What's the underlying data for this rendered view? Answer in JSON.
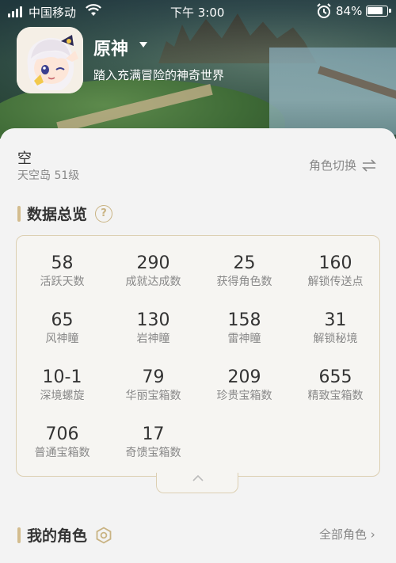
{
  "status_bar": {
    "carrier": "中国移动",
    "time": "下午 3:00",
    "battery": "84%",
    "battery_level": 0.84
  },
  "app": {
    "name": "原神",
    "tagline": "踏入充满冒险的神奇世界"
  },
  "character": {
    "name": "空",
    "server_level": "天空岛 51级",
    "switch_label": "角色切换"
  },
  "overview": {
    "title": "数据总览",
    "stats": [
      {
        "value": "58",
        "label": "活跃天数"
      },
      {
        "value": "290",
        "label": "成就达成数"
      },
      {
        "value": "25",
        "label": "获得角色数"
      },
      {
        "value": "160",
        "label": "解锁传送点"
      },
      {
        "value": "65",
        "label": "风神瞳"
      },
      {
        "value": "130",
        "label": "岩神瞳"
      },
      {
        "value": "158",
        "label": "雷神瞳"
      },
      {
        "value": "31",
        "label": "解锁秘境"
      },
      {
        "value": "10-1",
        "label": "深境螺旋"
      },
      {
        "value": "79",
        "label": "华丽宝箱数"
      },
      {
        "value": "209",
        "label": "珍贵宝箱数"
      },
      {
        "value": "655",
        "label": "精致宝箱数"
      },
      {
        "value": "706",
        "label": "普通宝箱数"
      },
      {
        "value": "17",
        "label": "奇馈宝箱数"
      }
    ]
  },
  "my_characters": {
    "title": "我的角色",
    "all_label": "全部角色 ›"
  },
  "colors": {
    "accent": "#d3bc8e",
    "border": "#dccfb2"
  }
}
